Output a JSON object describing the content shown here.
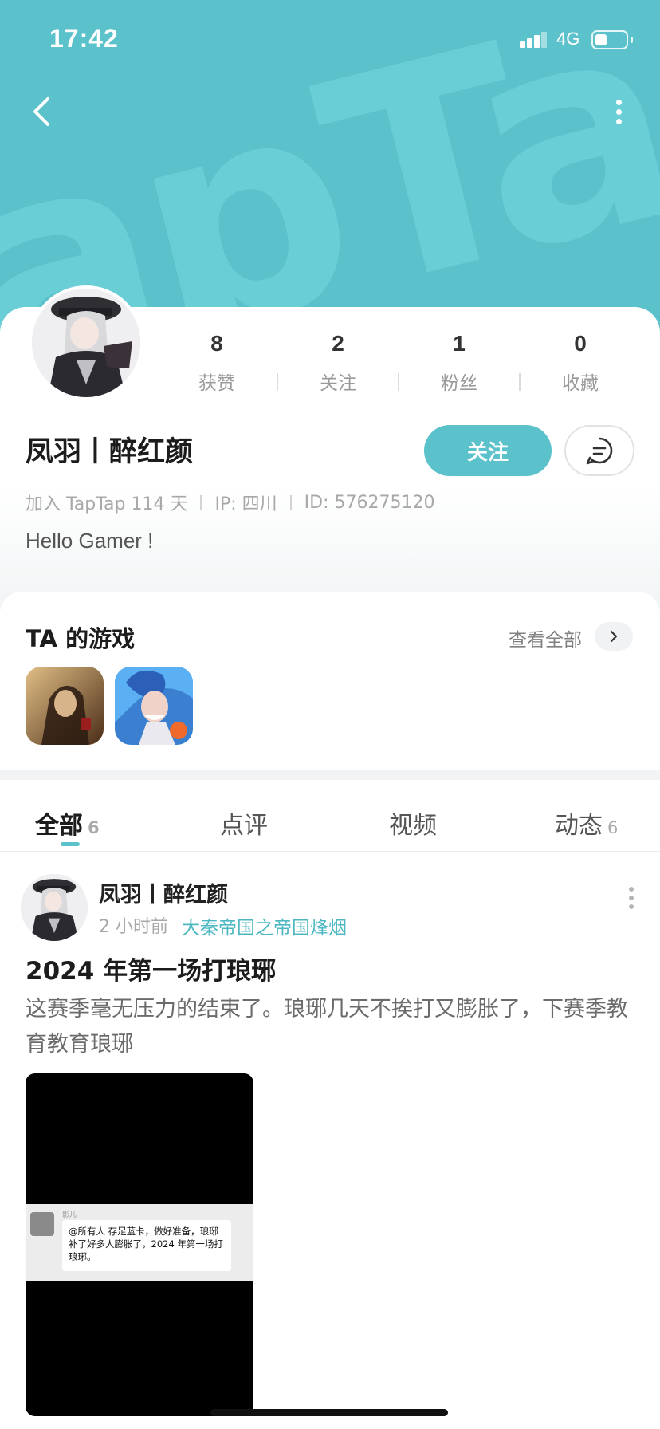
{
  "status_bar": {
    "time": "17:42",
    "network": "4G"
  },
  "header": {
    "watermark": "apTap"
  },
  "profile": {
    "stats": [
      {
        "value": "8",
        "label": "获赞"
      },
      {
        "value": "2",
        "label": "关注"
      },
      {
        "value": "1",
        "label": "粉丝"
      },
      {
        "value": "0",
        "label": "收藏"
      }
    ],
    "username": "凤羽丨醉红颜",
    "follow_label": "关注",
    "join_info": "加入 TapTap 114 天",
    "ip": "IP: 四川",
    "user_id": "ID: 576275120",
    "bio": "Hello Gamer !"
  },
  "games": {
    "title": "TA 的游戏",
    "view_all": "查看全部"
  },
  "tabs": [
    {
      "label": "全部",
      "count": "6"
    },
    {
      "label": "点评",
      "count": ""
    },
    {
      "label": "视频",
      "count": ""
    },
    {
      "label": "动态",
      "count": "6"
    }
  ],
  "post": {
    "author": "凤羽丨醉红颜",
    "time": "2 小时前",
    "game": "大秦帝国之帝国烽烟",
    "title": "2024 年第一场打琅琊",
    "body": "这赛季毫无压力的结束了。琅琊几天不挨打又膨胀了，下赛季教育教育琅琊",
    "image": {
      "chat_name": "影儿",
      "chat_text": "@所有人 存足蓝卡，做好准备，琅琊补了好多人膨胀了，2024 年第一场打琅琊。"
    }
  },
  "colors": {
    "accent": "#5bc2cc",
    "link": "#4db8c2"
  }
}
